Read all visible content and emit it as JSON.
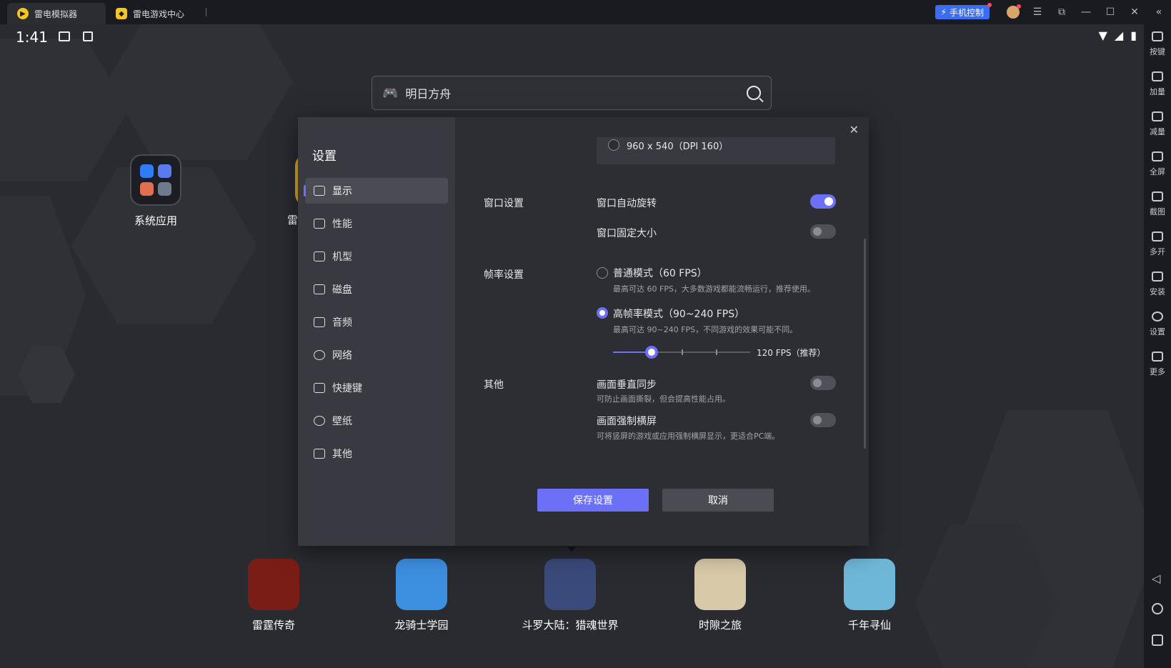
{
  "titlebar": {
    "tabs": [
      {
        "label": "雷电模拟器",
        "active": true
      },
      {
        "label": "雷电游戏中心",
        "active": false
      }
    ],
    "phone_control": "手机控制"
  },
  "status": {
    "time": "1:41"
  },
  "search": {
    "value": "明日方舟"
  },
  "desktop": {
    "system_apps_label": "系统应用",
    "partial_app_label": "雷"
  },
  "dock": [
    {
      "label": "雷霆传奇",
      "color": "#7a1d16"
    },
    {
      "label": "龙骑士学园",
      "color": "#3d8fe0"
    },
    {
      "label": "斗罗大陆：猎魂世界",
      "color": "#3a4a7a"
    },
    {
      "label": "时隙之旅",
      "color": "#d8c9a8"
    },
    {
      "label": "千年寻仙",
      "color": "#6fb7d8"
    }
  ],
  "right_toolbar": [
    {
      "label": "按键",
      "icon": "keyboard-icon"
    },
    {
      "label": "加量",
      "icon": "volume-up-icon"
    },
    {
      "label": "减量",
      "icon": "volume-down-icon"
    },
    {
      "label": "全屏",
      "icon": "fullscreen-icon"
    },
    {
      "label": "截图",
      "icon": "scissors-icon"
    },
    {
      "label": "多开",
      "icon": "multi-instance-icon"
    },
    {
      "label": "安装",
      "icon": "apk-icon"
    },
    {
      "label": "设置",
      "icon": "gear-icon"
    },
    {
      "label": "更多",
      "icon": "more-icon"
    }
  ],
  "settings": {
    "title": "设置",
    "menu": [
      {
        "label": "显示",
        "icon": "monitor-icon",
        "active": true
      },
      {
        "label": "性能",
        "icon": "performance-icon"
      },
      {
        "label": "机型",
        "icon": "folder-icon"
      },
      {
        "label": "磁盘",
        "icon": "disk-icon"
      },
      {
        "label": "音频",
        "icon": "gamepad-icon"
      },
      {
        "label": "网络",
        "icon": "globe-icon"
      },
      {
        "label": "快捷键",
        "icon": "keyboard-icon"
      },
      {
        "label": "壁纸",
        "icon": "palette-icon"
      },
      {
        "label": "其他",
        "icon": "grid-icon"
      }
    ],
    "resolution_option": "960 x 540（DPI 160）",
    "window": {
      "label": "窗口设置",
      "auto_rotate": {
        "label": "窗口自动旋转",
        "on": true
      },
      "fixed_size": {
        "label": "窗口固定大小",
        "on": false
      }
    },
    "fps": {
      "label": "帧率设置",
      "normal": {
        "label": "普通模式（60 FPS）",
        "desc": "最高可达 60 FPS，大多数游戏都能流畅运行，推荐使用。",
        "selected": false
      },
      "high": {
        "label": "高帧率模式（90~240 FPS）",
        "desc": "最高可达 90~240 FPS，不同游戏的效果可能不同。",
        "selected": true
      },
      "slider_value": "120 FPS（推荐）",
      "slider_position": 0.28
    },
    "other": {
      "label": "其他",
      "vsync": {
        "label": "画面垂直同步",
        "desc": "可防止画面撕裂，但会提高性能占用。",
        "on": false
      },
      "force_landscape": {
        "label": "画面强制横屏",
        "desc": "可将竖屏的游戏或应用强制横屏显示，更适合PC端。",
        "on": false
      }
    },
    "save_label": "保存设置",
    "cancel_label": "取消"
  },
  "colors": {
    "accent": "#6b70f6",
    "phone_control": "#3b6df2",
    "logo": "#f6c522"
  }
}
